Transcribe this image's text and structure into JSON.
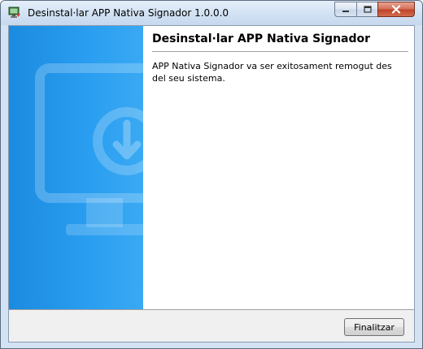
{
  "window": {
    "title": "Desinstal·lar APP Nativa Signador 1.0.0.0",
    "title_icon": "uninstall-icon",
    "controls": [
      "minimize-icon",
      "maximize-icon",
      "close-icon"
    ]
  },
  "page": {
    "heading": "Desinstal·lar APP Nativa Signador",
    "message": "APP Nativa Signador va ser exitosament remogut des del seu sistema."
  },
  "banner": {
    "icon": "monitor-download-icon",
    "color": "#1b8be0"
  },
  "footer": {
    "finish_label": "Finalitzar"
  }
}
